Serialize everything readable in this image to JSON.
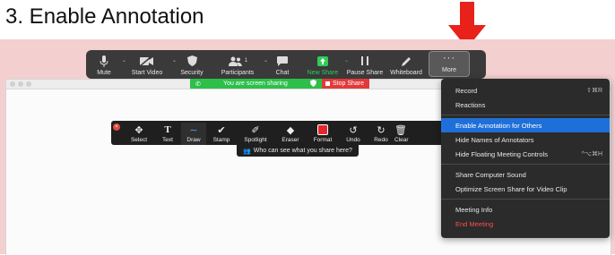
{
  "heading": "3.   Enable Annotation",
  "colors": {
    "desktop_bg": "#f4cfcf",
    "toolbar_bg": "#3a3a3a",
    "share_green": "#2dbf4a",
    "stop_red": "#e23a3a",
    "menu_highlight": "#1f6fd8",
    "arrow_red": "#e8211b"
  },
  "meeting_toolbar": {
    "items": [
      {
        "label": "Mute",
        "icon": "microphone-icon"
      },
      {
        "label": "Start Video",
        "icon": "video-off-icon"
      },
      {
        "label": "Security",
        "icon": "shield-icon"
      },
      {
        "label": "Participants",
        "icon": "participants-icon",
        "count": "1"
      },
      {
        "label": "Chat",
        "icon": "chat-icon"
      },
      {
        "label": "New Share",
        "icon": "share-up-icon"
      },
      {
        "label": "Pause Share",
        "icon": "pause-icon"
      },
      {
        "label": "Whiteboard",
        "icon": "pen-icon"
      },
      {
        "label": "More",
        "icon": "ellipsis-icon"
      }
    ]
  },
  "share_banner": {
    "text": "You are screen sharing",
    "stop_label": "Stop Share"
  },
  "annotation_toolbar": {
    "items": [
      {
        "label": "Select",
        "icon": "move-icon"
      },
      {
        "label": "Text",
        "icon": "text-icon"
      },
      {
        "label": "Draw",
        "icon": "draw-wave-icon"
      },
      {
        "label": "Stamp",
        "icon": "checkmark-icon"
      },
      {
        "label": "Spotlight",
        "icon": "spotlight-icon"
      },
      {
        "label": "Eraser",
        "icon": "eraser-icon"
      },
      {
        "label": "Format",
        "icon": "format-square-icon"
      },
      {
        "label": "Undo",
        "icon": "undo-icon"
      },
      {
        "label": "Redo",
        "icon": "redo-icon"
      },
      {
        "label": "Clear",
        "icon": "trash-icon"
      }
    ],
    "who_label": "Who can see what you share here?"
  },
  "more_menu": {
    "items": [
      {
        "label": "Record",
        "shortcut": "⇧⌘R"
      },
      {
        "label": "Reactions",
        "shortcut": ""
      },
      {
        "sep": true
      },
      {
        "label": "Enable Annotation for Others",
        "shortcut": "",
        "highlight": true
      },
      {
        "label": "Hide Names of Annotators",
        "shortcut": ""
      },
      {
        "label": "Hide Floating Meeting Controls",
        "shortcut": "^⌥⌘H"
      },
      {
        "sep": true
      },
      {
        "label": "Share Computer Sound",
        "shortcut": ""
      },
      {
        "label": "Optimize Screen Share for Video Clip",
        "shortcut": ""
      },
      {
        "sep": true
      },
      {
        "label": "Meeting Info",
        "shortcut": ""
      },
      {
        "label": "End Meeting",
        "shortcut": "",
        "danger": true
      }
    ]
  }
}
